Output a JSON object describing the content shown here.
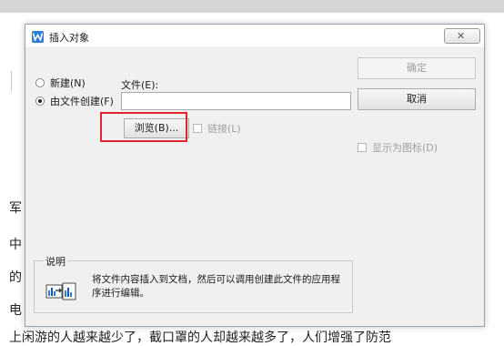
{
  "background": {
    "chars": [
      "军",
      "中",
      "的",
      "电"
    ],
    "bottom_line": "上闲游的人越来越少了，截口罩的人却越来越多了，人们增强了防范"
  },
  "dialog": {
    "title": "插入对象",
    "close_glyph": "✕",
    "options": {
      "new_label": "新建(N)",
      "from_file_label": "由文件创建(F)",
      "selected": "from_file"
    },
    "file_label": "文件(E):",
    "file_value": "",
    "browse_label": "浏览(B)...",
    "link_label": "链接(L)",
    "display_as_icon_label": "显示为图标(D)",
    "ok_label": "确定",
    "cancel_label": "取消",
    "description_title": "说明",
    "description_text": "将文件内容插入到文档，然后可以调用创建此文件的应用程序进行编辑。",
    "accent_color": "#2e7bd8",
    "highlight_color": "#e0262b"
  }
}
